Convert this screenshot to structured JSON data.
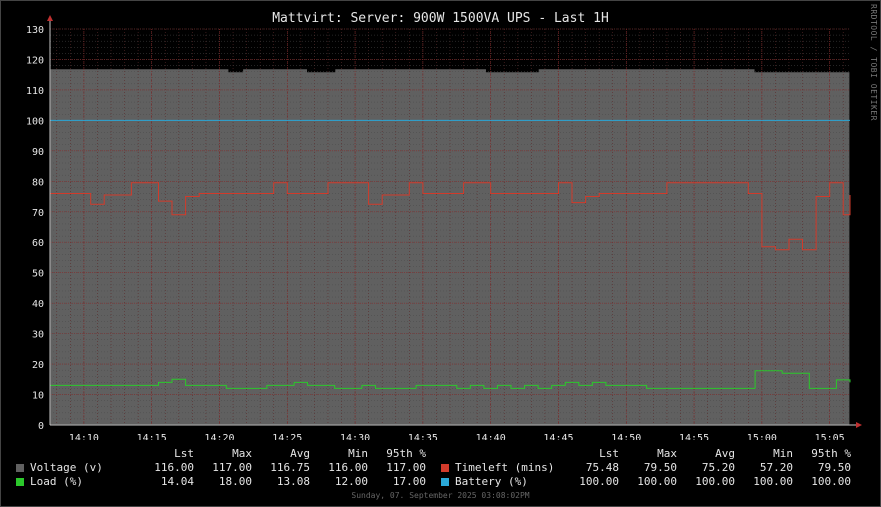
{
  "chart_data": {
    "type": "line",
    "title": "Mattvirt: Server: 900W 1500VA UPS - Last 1H",
    "vertical_label": "RRDTOOL / TOBI OETIKER",
    "ylim": [
      0,
      130
    ],
    "y_ticks": [
      0,
      10,
      20,
      30,
      40,
      50,
      60,
      70,
      80,
      90,
      100,
      110,
      120,
      130
    ],
    "x_range": [
      7.5,
      66.5
    ],
    "x_ticks": [
      {
        "value": 10,
        "label": "14:10"
      },
      {
        "value": 15,
        "label": "14:15"
      },
      {
        "value": 20,
        "label": "14:20"
      },
      {
        "value": 25,
        "label": "14:25"
      },
      {
        "value": 30,
        "label": "14:30"
      },
      {
        "value": 35,
        "label": "14:35"
      },
      {
        "value": 40,
        "label": "14:40"
      },
      {
        "value": 45,
        "label": "14:45"
      },
      {
        "value": 50,
        "label": "14:50"
      },
      {
        "value": 55,
        "label": "14:55"
      },
      {
        "value": 60,
        "label": "15:00"
      },
      {
        "value": 65,
        "label": "15:05"
      }
    ],
    "grid": true,
    "series": [
      {
        "name": "Voltage (v)",
        "kind": "area",
        "color": "#606060",
        "points": [
          [
            7.5,
            117
          ],
          [
            20.7,
            117
          ],
          [
            20.7,
            116
          ],
          [
            21.7,
            116
          ],
          [
            21.7,
            117
          ],
          [
            26.5,
            117
          ],
          [
            26.5,
            116
          ],
          [
            28.5,
            116
          ],
          [
            28.5,
            117
          ],
          [
            39.7,
            117
          ],
          [
            39.7,
            116
          ],
          [
            43.5,
            116
          ],
          [
            43.5,
            117
          ],
          [
            59.5,
            117
          ],
          [
            59.5,
            116
          ],
          [
            66.5,
            116
          ]
        ]
      },
      {
        "name": "Battery (%)",
        "kind": "line",
        "color": "#2aa8d8",
        "points": [
          [
            7.5,
            100
          ],
          [
            66.5,
            100
          ]
        ]
      },
      {
        "name": "Timeleft (mins)",
        "kind": "line",
        "color": "#d23a2a",
        "points": [
          [
            7.5,
            76
          ],
          [
            10.5,
            76
          ],
          [
            10.5,
            72.5
          ],
          [
            11.5,
            72.5
          ],
          [
            11.5,
            75.5
          ],
          [
            13.5,
            75.5
          ],
          [
            13.5,
            79.5
          ],
          [
            15.5,
            79.5
          ],
          [
            15.5,
            73.5
          ],
          [
            16.5,
            73.5
          ],
          [
            16.5,
            69
          ],
          [
            17.5,
            69
          ],
          [
            17.5,
            75
          ],
          [
            18.5,
            75
          ],
          [
            18.5,
            76
          ],
          [
            24,
            76
          ],
          [
            24,
            79.5
          ],
          [
            25,
            79.5
          ],
          [
            25,
            76
          ],
          [
            28,
            76
          ],
          [
            28,
            79.5
          ],
          [
            31,
            79.5
          ],
          [
            31,
            72.5
          ],
          [
            32,
            72.5
          ],
          [
            32,
            75.5
          ],
          [
            34,
            75.5
          ],
          [
            34,
            79.5
          ],
          [
            35,
            79.5
          ],
          [
            35,
            76
          ],
          [
            38,
            76
          ],
          [
            38,
            79.5
          ],
          [
            40,
            79.5
          ],
          [
            40,
            76
          ],
          [
            45,
            76
          ],
          [
            45,
            79.5
          ],
          [
            46,
            79.5
          ],
          [
            46,
            73
          ],
          [
            47,
            73
          ],
          [
            47,
            75
          ],
          [
            48,
            75
          ],
          [
            48,
            76
          ],
          [
            53,
            76
          ],
          [
            53,
            79.5
          ],
          [
            59,
            79.5
          ],
          [
            59,
            76
          ],
          [
            60,
            76
          ],
          [
            60,
            58.5
          ],
          [
            61,
            58.5
          ],
          [
            61,
            57.5
          ],
          [
            62,
            57.5
          ],
          [
            62,
            61
          ],
          [
            63,
            61
          ],
          [
            63,
            57.5
          ],
          [
            64,
            57.5
          ],
          [
            64,
            75
          ],
          [
            65,
            75
          ],
          [
            65,
            79.5
          ],
          [
            66,
            79.5
          ],
          [
            66,
            69
          ],
          [
            67,
            69
          ],
          [
            67,
            75.5
          ],
          [
            66.5,
            75.5
          ]
        ]
      },
      {
        "name": "Load (%)",
        "kind": "line",
        "color": "#2bc82b",
        "points": [
          [
            7.5,
            13
          ],
          [
            15.5,
            13
          ],
          [
            15.5,
            14
          ],
          [
            16.5,
            14
          ],
          [
            16.5,
            15
          ],
          [
            17.5,
            15
          ],
          [
            17.5,
            13
          ],
          [
            20.5,
            13
          ],
          [
            20.5,
            12
          ],
          [
            23.5,
            12
          ],
          [
            23.5,
            13
          ],
          [
            25.5,
            13
          ],
          [
            25.5,
            14
          ],
          [
            26.5,
            14
          ],
          [
            26.5,
            13
          ],
          [
            28.5,
            13
          ],
          [
            28.5,
            12
          ],
          [
            30.5,
            12
          ],
          [
            30.5,
            13
          ],
          [
            31.5,
            13
          ],
          [
            31.5,
            12
          ],
          [
            34.5,
            12
          ],
          [
            34.5,
            13
          ],
          [
            37.5,
            13
          ],
          [
            37.5,
            12
          ],
          [
            38.5,
            12
          ],
          [
            38.5,
            13
          ],
          [
            39.5,
            13
          ],
          [
            39.5,
            12
          ],
          [
            40.5,
            12
          ],
          [
            40.5,
            13
          ],
          [
            41.5,
            13
          ],
          [
            41.5,
            12
          ],
          [
            42.5,
            12
          ],
          [
            42.5,
            13
          ],
          [
            43.5,
            13
          ],
          [
            43.5,
            12
          ],
          [
            44.5,
            12
          ],
          [
            44.5,
            13
          ],
          [
            45.5,
            13
          ],
          [
            45.5,
            14
          ],
          [
            46.5,
            14
          ],
          [
            46.5,
            13
          ],
          [
            47.5,
            13
          ],
          [
            47.5,
            14
          ],
          [
            48.5,
            14
          ],
          [
            48.5,
            13
          ],
          [
            51.5,
            13
          ],
          [
            51.5,
            12
          ],
          [
            59.5,
            12
          ],
          [
            59.5,
            17.8
          ],
          [
            61.5,
            17.8
          ],
          [
            61.5,
            17
          ],
          [
            63.5,
            17
          ],
          [
            63.5,
            12
          ],
          [
            65.5,
            12
          ],
          [
            65.5,
            14.8
          ],
          [
            66.5,
            14.8
          ],
          [
            66.5,
            14
          ]
        ]
      }
    ]
  },
  "legend": {
    "headers": [
      "Lst",
      "Max",
      "Avg",
      "Min",
      "95th %"
    ],
    "left": [
      {
        "name": "Voltage (v)",
        "color": "#606060",
        "values": [
          "116.00",
          "117.00",
          "116.75",
          "116.00",
          "117.00"
        ]
      },
      {
        "name": "Load (%)",
        "color": "#2bc82b",
        "values": [
          "14.04",
          "18.00",
          "13.08",
          "12.00",
          "17.00"
        ]
      }
    ],
    "right": [
      {
        "name": "Timeleft (mins)",
        "color": "#d23a2a",
        "values": [
          "75.48",
          "79.50",
          "75.20",
          "57.20",
          "79.50"
        ]
      },
      {
        "name": "Battery (%)",
        "color": "#2aa8d8",
        "values": [
          "100.00",
          "100.00",
          "100.00",
          "100.00",
          "100.00"
        ]
      }
    ]
  },
  "footer": "Sunday, 07. September 2025 03:08:02PM"
}
